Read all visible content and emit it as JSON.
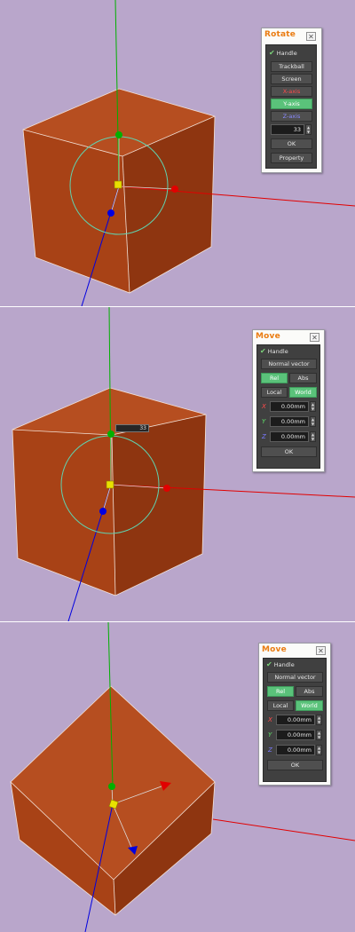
{
  "colors": {
    "viewport_bg": "#b9a6cb",
    "cube_top": "#b64e20",
    "cube_front": "#a84216",
    "cube_side": "#8e3510",
    "accent": "#ea7c12",
    "active_button": "#5ac27a",
    "axis_x": "#e10000",
    "axis_y": "#00b000",
    "axis_z": "#0000e0",
    "handle_center": "#e8e000",
    "ring": "#5fd3b0"
  },
  "rotate_dialog": {
    "title": "Rotate",
    "close_icon": "close-icon",
    "handle_label": "Handle",
    "handle_checked": true,
    "buttons": [
      "Trackball",
      "Screen",
      "X-axis",
      "Y-axis",
      "Z-axis"
    ],
    "active_button": "Y-axis",
    "angle_value": "33",
    "ok_label": "OK",
    "property_label": "Property"
  },
  "move_dialog_1": {
    "title": "Move",
    "handle_label": "Handle",
    "handle_checked": true,
    "normal_vector_label": "Normal vector",
    "rel_label": "Rel",
    "abs_label": "Abs",
    "rel_active": true,
    "local_label": "Local",
    "world_label": "World",
    "world_active": true,
    "fields": [
      {
        "axis": "X",
        "value": "0.00mm"
      },
      {
        "axis": "Y",
        "value": "0.00mm"
      },
      {
        "axis": "Z",
        "value": "0.00mm"
      }
    ],
    "ok_label": "OK"
  },
  "move_dialog_2": {
    "title": "Move",
    "handle_label": "Handle",
    "handle_checked": true,
    "normal_vector_label": "Normal vector",
    "rel_label": "Rel",
    "abs_label": "Abs",
    "rel_active": true,
    "local_label": "Local",
    "world_label": "World",
    "world_active": true,
    "fields": [
      {
        "axis": "X",
        "value": "0.00mm"
      },
      {
        "axis": "Y",
        "value": "0.00mm"
      },
      {
        "axis": "Z",
        "value": "0.00mm"
      }
    ],
    "ok_label": "OK"
  },
  "viewport_angle_tag": "33"
}
